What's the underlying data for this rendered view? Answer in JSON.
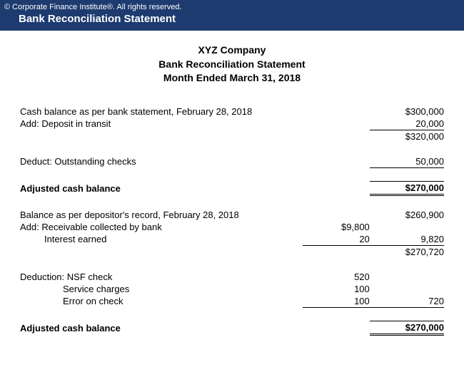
{
  "header": {
    "copyright": "© Corporate Finance Institute®. All rights reserved.",
    "title": "Bank Reconciliation Statement"
  },
  "title": {
    "company": "XYZ Company",
    "statement": "Bank Reconciliation Statement",
    "period": "Month Ended March 31, 2018"
  },
  "bank": {
    "cash_balance_label": "Cash balance as per bank statement, February 28, 2018",
    "cash_balance": "$300,000",
    "deposit_label": "Add:  Deposit in transit",
    "deposit": "20,000",
    "subtotal": "$320,000",
    "deduct_label": "Deduct:  Outstanding checks",
    "deduct": "50,000",
    "adjusted_label": "Adjusted cash balance",
    "adjusted": "$270,000"
  },
  "book": {
    "balance_label": "Balance as per depositor's record, February 28, 2018",
    "balance": "$260,900",
    "add_label": "Add:  Receivable collected by bank",
    "receivable": "$9,800",
    "interest_label": "Interest earned",
    "interest": "20",
    "add_total": "9,820",
    "subtotal": "$270,720",
    "deduct_label": "Deduction:  NSF check",
    "nsf": "520",
    "service_label": "Service charges",
    "service": "100",
    "error_label": "Error on check",
    "error": "100",
    "deduct_total": "720",
    "adjusted_label": "Adjusted cash balance",
    "adjusted": "$270,000"
  }
}
